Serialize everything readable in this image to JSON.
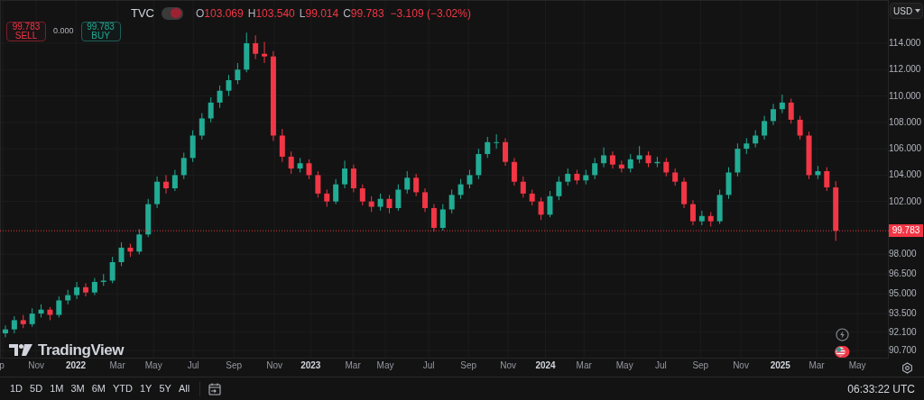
{
  "legend": {
    "exchange": "TVC",
    "display_toggle": {
      "on": true
    },
    "ohlc": [
      {
        "letter": "O",
        "value": "103.069"
      },
      {
        "letter": "H",
        "value": "103.540"
      },
      {
        "letter": "L",
        "value": "99.014"
      },
      {
        "letter": "C",
        "value": "99.783"
      }
    ],
    "change": "−3.109 (−3.02%)"
  },
  "trade": {
    "sell": {
      "price": "99.783",
      "label": "SELL"
    },
    "spread": "0.000",
    "buy": {
      "price": "99.783",
      "label": "BUY"
    }
  },
  "currency": "USD",
  "chart_data": {
    "type": "candlestick",
    "grid": true,
    "xlim": [
      2021.677,
      2025.462
    ],
    "ylim": [
      90.09,
      117.28
    ],
    "x": [
      2021.7,
      2021.738,
      2021.776,
      2021.814,
      2021.852,
      2021.89,
      2021.928,
      2021.966,
      2022.004,
      2022.042,
      2022.08,
      2022.118,
      2022.156,
      2022.194,
      2022.232,
      2022.27,
      2022.308,
      2022.346,
      2022.384,
      2022.422,
      2022.46,
      2022.498,
      2022.537,
      2022.575,
      2022.613,
      2022.651,
      2022.689,
      2022.727,
      2022.765,
      2022.803,
      2022.841,
      2022.879,
      2022.917,
      2022.955,
      2022.993,
      2023.031,
      2023.069,
      2023.107,
      2023.145,
      2023.183,
      2023.221,
      2023.259,
      2023.297,
      2023.335,
      2023.373,
      2023.411,
      2023.449,
      2023.487,
      2023.525,
      2023.563,
      2023.601,
      2023.639,
      2023.677,
      2023.715,
      2023.753,
      2023.791,
      2023.829,
      2023.867,
      2023.905,
      2023.943,
      2023.981,
      2024.019,
      2024.057,
      2024.095,
      2024.134,
      2024.172,
      2024.21,
      2024.248,
      2024.286,
      2024.324,
      2024.362,
      2024.4,
      2024.438,
      2024.476,
      2024.514,
      2024.552,
      2024.59,
      2024.628,
      2024.666,
      2024.704,
      2024.742,
      2024.78,
      2024.818,
      2024.856,
      2024.894,
      2024.932,
      2024.97,
      2025.008,
      2025.046,
      2025.084,
      2025.122,
      2025.16,
      2025.198,
      2025.236
    ],
    "ohlc": [
      [
        92.0,
        92.6,
        91.7,
        92.3
      ],
      [
        92.3,
        93.3,
        92.0,
        93.0
      ],
      [
        93.0,
        93.4,
        92.4,
        92.7
      ],
      [
        92.7,
        93.9,
        92.5,
        93.5
      ],
      [
        93.5,
        94.2,
        93.2,
        93.8
      ],
      [
        93.8,
        94.0,
        93.0,
        93.4
      ],
      [
        93.4,
        94.8,
        93.2,
        94.5
      ],
      [
        94.5,
        95.3,
        94.2,
        94.9
      ],
      [
        94.9,
        95.9,
        94.6,
        95.5
      ],
      [
        95.5,
        95.8,
        94.8,
        95.1
      ],
      [
        95.1,
        96.2,
        94.9,
        95.9
      ],
      [
        95.9,
        96.5,
        95.6,
        96.0
      ],
      [
        96.0,
        97.8,
        95.8,
        97.4
      ],
      [
        97.4,
        98.9,
        97.1,
        98.5
      ],
      [
        98.5,
        98.8,
        97.8,
        98.2
      ],
      [
        98.2,
        99.9,
        98.0,
        99.5
      ],
      [
        99.5,
        102.2,
        99.3,
        101.8
      ],
      [
        101.8,
        103.9,
        101.5,
        103.5
      ],
      [
        103.5,
        104.0,
        102.6,
        103.0
      ],
      [
        103.0,
        104.4,
        102.8,
        104.0
      ],
      [
        104.0,
        105.7,
        103.7,
        105.3
      ],
      [
        105.3,
        107.4,
        105.0,
        107.0
      ],
      [
        107.0,
        108.7,
        106.7,
        108.3
      ],
      [
        108.3,
        109.9,
        108.0,
        109.5
      ],
      [
        109.5,
        110.8,
        109.1,
        110.4
      ],
      [
        110.4,
        111.6,
        110.0,
        111.2
      ],
      [
        111.2,
        112.5,
        110.9,
        112.0
      ],
      [
        112.0,
        114.8,
        111.8,
        114.0
      ],
      [
        114.0,
        114.6,
        112.8,
        113.2
      ],
      [
        113.2,
        114.1,
        112.5,
        113.0
      ],
      [
        113.0,
        113.4,
        106.6,
        107.0
      ],
      [
        107.0,
        107.5,
        105.0,
        105.4
      ],
      [
        105.4,
        105.8,
        104.1,
        104.5
      ],
      [
        104.5,
        105.3,
        104.2,
        104.9
      ],
      [
        104.9,
        105.2,
        103.7,
        104.0
      ],
      [
        104.0,
        104.3,
        102.3,
        102.6
      ],
      [
        102.6,
        102.9,
        101.6,
        102.0
      ],
      [
        102.0,
        103.7,
        101.8,
        103.3
      ],
      [
        103.3,
        105.1,
        103.0,
        104.5
      ],
      [
        104.5,
        104.8,
        102.7,
        103.0
      ],
      [
        103.0,
        103.3,
        101.7,
        102.0
      ],
      [
        102.0,
        102.4,
        101.2,
        101.6
      ],
      [
        101.6,
        102.6,
        101.3,
        102.2
      ],
      [
        102.2,
        102.5,
        101.1,
        101.5
      ],
      [
        101.5,
        103.3,
        101.3,
        102.9
      ],
      [
        102.9,
        104.3,
        102.6,
        103.8
      ],
      [
        103.8,
        104.1,
        102.4,
        102.7
      ],
      [
        102.7,
        103.0,
        101.2,
        101.5
      ],
      [
        101.5,
        101.8,
        99.7,
        100.0
      ],
      [
        100.0,
        101.8,
        99.8,
        101.4
      ],
      [
        101.4,
        102.9,
        101.1,
        102.5
      ],
      [
        102.5,
        103.7,
        102.2,
        103.3
      ],
      [
        103.3,
        104.4,
        103.0,
        104.0
      ],
      [
        104.0,
        106.0,
        103.7,
        105.6
      ],
      [
        105.6,
        106.9,
        105.3,
        106.5
      ],
      [
        106.5,
        107.1,
        106.0,
        106.5
      ],
      [
        106.5,
        106.8,
        104.7,
        105.0
      ],
      [
        105.0,
        105.3,
        103.2,
        103.5
      ],
      [
        103.5,
        103.9,
        102.3,
        102.6
      ],
      [
        102.6,
        102.9,
        101.7,
        102.0
      ],
      [
        102.0,
        102.3,
        100.6,
        101.0
      ],
      [
        101.0,
        102.8,
        100.8,
        102.4
      ],
      [
        102.4,
        103.9,
        102.1,
        103.5
      ],
      [
        103.5,
        104.5,
        103.2,
        104.1
      ],
      [
        104.1,
        104.4,
        103.3,
        103.6
      ],
      [
        103.6,
        104.4,
        103.3,
        104.0
      ],
      [
        104.0,
        105.3,
        103.7,
        104.9
      ],
      [
        104.9,
        106.1,
        104.6,
        105.5
      ],
      [
        105.5,
        105.8,
        104.5,
        104.8
      ],
      [
        104.8,
        105.1,
        104.2,
        104.5
      ],
      [
        104.5,
        105.6,
        104.2,
        105.2
      ],
      [
        105.2,
        106.2,
        104.9,
        105.5
      ],
      [
        105.5,
        105.8,
        104.6,
        104.9
      ],
      [
        104.9,
        105.4,
        104.6,
        105.0
      ],
      [
        105.0,
        105.3,
        103.9,
        104.2
      ],
      [
        104.2,
        104.5,
        103.2,
        103.5
      ],
      [
        103.5,
        103.8,
        101.5,
        101.8
      ],
      [
        101.8,
        102.1,
        100.2,
        100.5
      ],
      [
        100.5,
        101.3,
        100.2,
        100.9
      ],
      [
        100.9,
        101.2,
        100.1,
        100.5
      ],
      [
        100.5,
        102.9,
        100.3,
        102.5
      ],
      [
        102.5,
        104.6,
        102.2,
        104.2
      ],
      [
        104.2,
        106.4,
        103.9,
        106.0
      ],
      [
        106.0,
        106.8,
        105.6,
        106.4
      ],
      [
        106.4,
        107.4,
        106.1,
        107.0
      ],
      [
        107.0,
        108.5,
        106.7,
        108.1
      ],
      [
        108.1,
        109.4,
        107.8,
        109.0
      ],
      [
        109.0,
        110.1,
        108.7,
        109.5
      ],
      [
        109.5,
        109.8,
        107.9,
        108.2
      ],
      [
        108.2,
        108.5,
        106.7,
        107.0
      ],
      [
        107.0,
        107.3,
        103.7,
        104.0
      ],
      [
        104.0,
        104.7,
        103.7,
        104.3
      ],
      [
        104.3,
        104.6,
        102.8,
        103.069
      ],
      [
        103.069,
        103.54,
        99.014,
        99.783
      ]
    ],
    "xticks": [
      {
        "value": 2021.689,
        "label": "p"
      },
      {
        "value": 2021.831,
        "label": "Nov"
      },
      2022,
      {
        "value": 2022.177,
        "label": "Mar"
      },
      {
        "value": 2022.331,
        "label": "May"
      },
      {
        "value": 2022.5,
        "label": "Jul"
      },
      {
        "value": 2022.673,
        "label": "Sep"
      },
      {
        "value": 2022.846,
        "label": "Nov"
      },
      2023,
      {
        "value": 2023.18,
        "label": "Mar"
      },
      {
        "value": 2023.318,
        "label": "May"
      },
      {
        "value": 2023.503,
        "label": "Jul"
      },
      {
        "value": 2023.672,
        "label": "Sep"
      },
      {
        "value": 2023.841,
        "label": "Nov"
      },
      2024,
      {
        "value": 2024.164,
        "label": "Mar"
      },
      {
        "value": 2024.337,
        "label": "May"
      },
      {
        "value": 2024.491,
        "label": "Jul"
      },
      {
        "value": 2024.66,
        "label": "Sep"
      },
      {
        "value": 2024.832,
        "label": "Nov"
      },
      2025,
      {
        "value": 2025.155,
        "label": "Mar"
      },
      {
        "value": 2025.328,
        "label": "May"
      }
    ],
    "yticks": [
      {
        "value": 114,
        "label": "114.000"
      },
      {
        "value": 112,
        "label": "112.000"
      },
      {
        "value": 110,
        "label": "110.000"
      },
      {
        "value": 108,
        "label": "108.000"
      },
      {
        "value": 106,
        "label": "106.000"
      },
      {
        "value": 104,
        "label": "104.000"
      },
      {
        "value": 102,
        "label": "102.000"
      },
      {
        "value": 98,
        "label": "98.000"
      },
      {
        "value": 96.5,
        "label": "96.500"
      },
      {
        "value": 95,
        "label": "95.000"
      },
      {
        "value": 93.5,
        "label": "93.500"
      },
      {
        "value": 92.1,
        "label": "92.100"
      },
      {
        "value": 90.7,
        "label": "90.700"
      }
    ],
    "ref_lines": [
      {
        "axis": "y",
        "value": 99.783,
        "label": "99.783",
        "color": "#f23645"
      }
    ]
  },
  "brand": "TradingView",
  "ranges": [
    "1D",
    "5D",
    "1M",
    "3M",
    "6M",
    "YTD",
    "1Y",
    "5Y",
    "All"
  ],
  "clock": "06:33:22 UTC"
}
